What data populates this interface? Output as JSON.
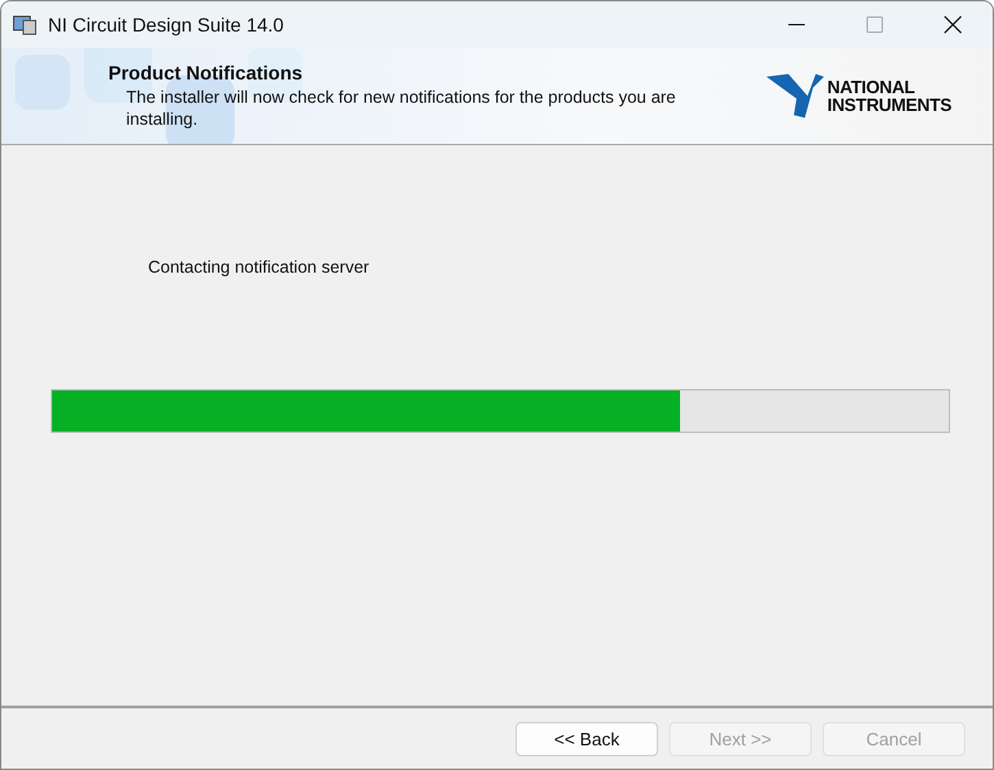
{
  "window": {
    "title": "NI Circuit Design Suite 14.0"
  },
  "header": {
    "title": "Product Notifications",
    "description": "The installer will now check for new notifications for the products you are installing.",
    "logo_lines": [
      "NATIONAL",
      "INSTRUMENTS"
    ]
  },
  "status": "Contacting notification server",
  "progress": {
    "level": 0.7
  },
  "buttons": [
    {
      "label": "<< Back",
      "disabled": false
    },
    {
      "label": "Next >>",
      "disabled": true
    },
    {
      "label": "Cancel",
      "disabled": true
    }
  ]
}
